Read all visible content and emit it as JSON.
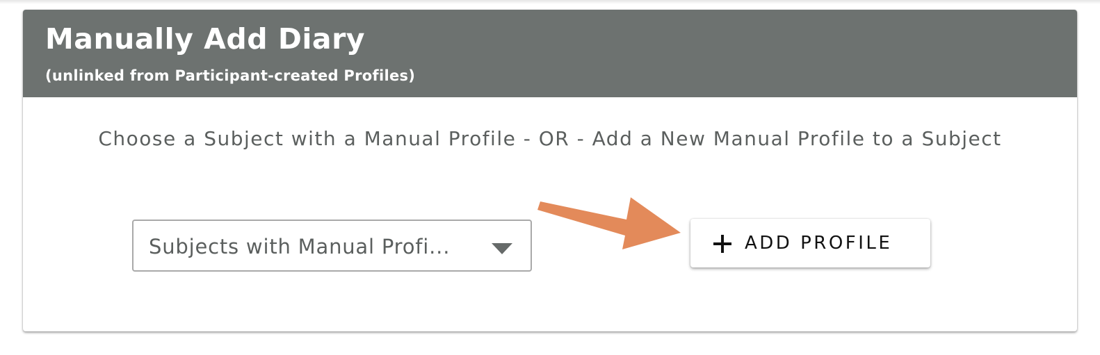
{
  "card": {
    "title": "Manually Add Diary",
    "subtitle": "(unlinked from Participant-created Profiles)",
    "instruction": "Choose a Subject with a Manual Profile - OR - Add a New Manual Profile to a Subject"
  },
  "subject_select": {
    "value": "Subjects with Manual Profi...",
    "icon": "caret-down-icon"
  },
  "add_profile_button": {
    "label": "ADD PROFILE",
    "icon": "plus-icon"
  },
  "annotation": {
    "icon": "arrow-icon",
    "color": "#e38a5a"
  },
  "colors": {
    "header_bg": "#6d7270",
    "header_text": "#ffffff",
    "body_text": "#5b5f5e",
    "button_text": "#111111"
  }
}
